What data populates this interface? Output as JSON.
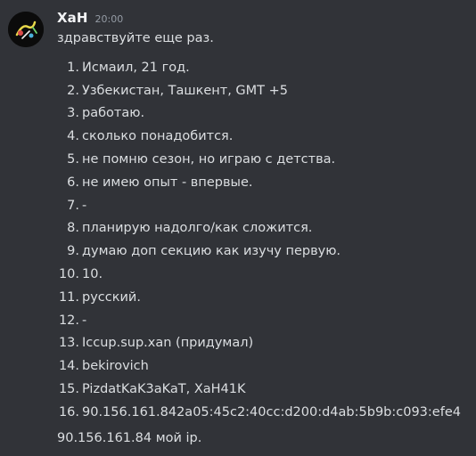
{
  "message": {
    "username": "XaH",
    "timestamp": "20:00",
    "greeting": "здравствуйте еще раз.",
    "items": [
      {
        "num": "1.",
        "text": "Исмаил, 21 год."
      },
      {
        "num": "2.",
        "text": "Узбекистан, Ташкент, GMT +5"
      },
      {
        "num": "3.",
        "text": "работаю."
      },
      {
        "num": "4.",
        "text": "сколько понадобится."
      },
      {
        "num": "5.",
        "text": "не помню сезон, но играю с детства."
      },
      {
        "num": "6.",
        "text": "не имею опыт - впервые."
      },
      {
        "num": "7.",
        "text": "-"
      },
      {
        "num": "8.",
        "text": "планирую надолго/как сложится."
      },
      {
        "num": "9.",
        "text": "думаю доп секцию как изучу первую."
      },
      {
        "num": "10.",
        "text": "10."
      },
      {
        "num": "11.",
        "text": "русский."
      },
      {
        "num": "12.",
        "text": "-"
      },
      {
        "num": "13.",
        "text": "Iccup.sup.xan (придумал)"
      },
      {
        "num": "14.",
        "text": "bekirovich"
      },
      {
        "num": "15.",
        "text": "PizdatKaK3aKaT, XaH41K"
      },
      {
        "num": "16.",
        "text": "90.156.161.842a05:45c2:40cc:d200:d4ab:5b9b:c093:efe4"
      }
    ],
    "footer": "90.156.161.84 мой ip."
  },
  "colors": {
    "background": "#313338",
    "text": "#dbdee1",
    "username": "#f2f3f5",
    "timestamp": "#949ba4"
  }
}
